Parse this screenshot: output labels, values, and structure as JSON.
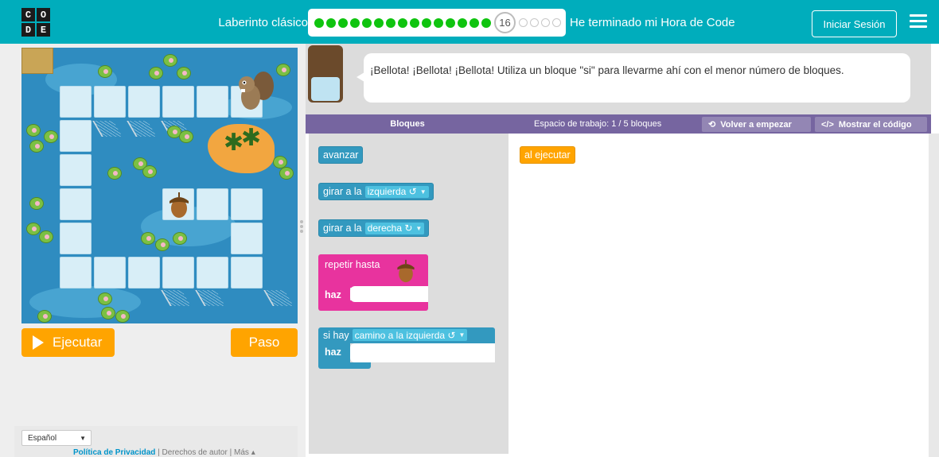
{
  "header": {
    "logo_letters": [
      "C",
      "O",
      "D",
      "E"
    ],
    "level_title": "Laberinto clásico",
    "current_level": "16",
    "completed_levels": 15,
    "remaining_levels": 4,
    "finish_text": "He terminado mi Hora de Code",
    "signin_label": "Iniciar Sesión",
    "colors": {
      "bar": "#00adbc",
      "completed": "#0fc40f"
    }
  },
  "game": {
    "run_label": "Ejecutar",
    "step_label": "Paso"
  },
  "footer": {
    "language": "Español",
    "links": [
      "Política de Privacidad",
      "Derechos de autor",
      "Más"
    ],
    "separator": "|"
  },
  "instructions": {
    "text": "¡Bellota! ¡Bellota! ¡Bellota! Utiliza un bloque \"si\" para llevarme ahí con el menor número de bloques."
  },
  "workspace_header": {
    "toolbox_title": "Bloques",
    "workspace_title": "Espacio de trabajo: 1 / 5 bloques",
    "reset_label": "Volver a empezar",
    "code_label": "Mostrar el código"
  },
  "toolbox": {
    "move_forward": "avanzar",
    "turn_prefix": "girar a la",
    "turn_left_option": "izquierda ↺",
    "turn_right_option": "derecha ↻",
    "repeat_until": "repetir hasta",
    "do_label": "haz",
    "if_prefix": "si hay",
    "if_option": "camino a la izquierda ↺"
  },
  "workspace": {
    "when_run": "al ejecutar"
  },
  "icons": {
    "dropdown": "▼",
    "reset": "⟲",
    "code": "</>",
    "acorn": "acorn-icon"
  }
}
